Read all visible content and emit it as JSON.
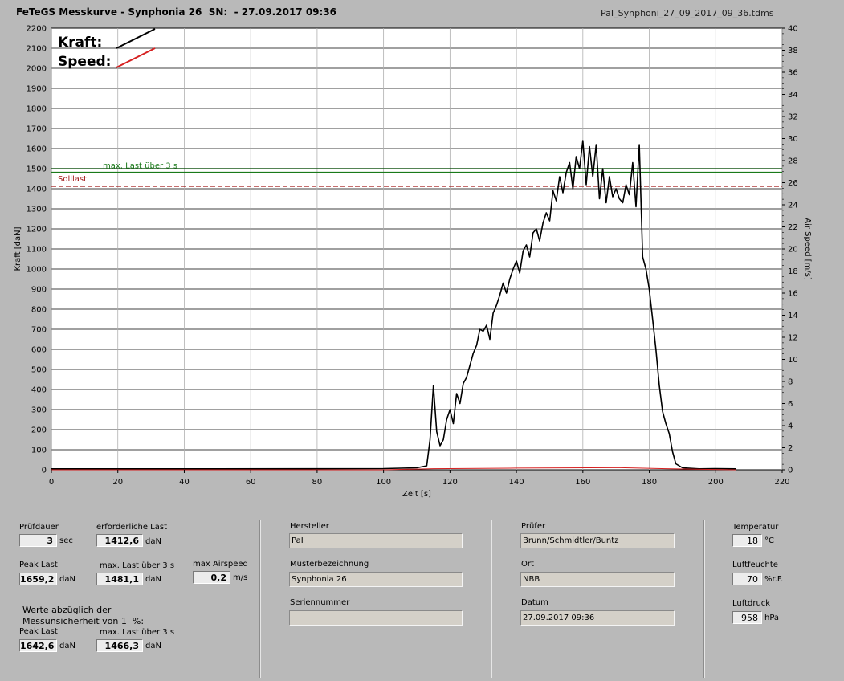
{
  "header": {
    "title": "FeTeGS Messkurve - Synphonia 26  SN:  - 27.09.2017 09:36",
    "filename": "PaI_Synphoni_27_09_2017_09_36.tdms"
  },
  "chart_data": {
    "type": "line",
    "xlabel": "Zeit [s]",
    "ylabel": "Kraft [daN]",
    "y2label": "Air Speed [m/s]",
    "xlim": [
      0,
      220
    ],
    "ylim": [
      0,
      2200
    ],
    "y2lim": [
      0,
      40
    ],
    "x_ticks": [
      0,
      20,
      40,
      60,
      80,
      100,
      120,
      140,
      160,
      180,
      200,
      220
    ],
    "y_ticks": [
      0,
      100,
      200,
      300,
      400,
      500,
      600,
      700,
      800,
      900,
      1000,
      1100,
      1200,
      1300,
      1400,
      1500,
      1600,
      1700,
      1800,
      1900,
      2000,
      2100,
      2200
    ],
    "y2_ticks": [
      0,
      2,
      4,
      6,
      8,
      10,
      12,
      14,
      16,
      18,
      20,
      22,
      24,
      26,
      28,
      30,
      32,
      34,
      36,
      38,
      40
    ],
    "grid": true,
    "legend_position": "top-left",
    "legend": [
      {
        "name": "Kraft:",
        "color": "#000000"
      },
      {
        "name": "Speed:",
        "color": "#d62020"
      }
    ],
    "reference_lines": [
      {
        "label": "max. Last über  3 s",
        "y": 1481.1,
        "color": "#1a7a1a"
      },
      {
        "label": "",
        "y": 1500,
        "color": "#1a5a1a"
      },
      {
        "label": "Solllast",
        "y": 1412.6,
        "color": "#a01818",
        "dashed": true
      }
    ],
    "series": [
      {
        "name": "Kraft",
        "color": "#000000",
        "x": [
          0,
          50,
          100,
          110,
          113,
          114,
          115,
          116,
          117,
          118,
          119,
          120,
          121,
          122,
          123,
          124,
          125,
          126,
          127,
          128,
          129,
          130,
          131,
          132,
          133,
          134,
          135,
          136,
          137,
          138,
          139,
          140,
          141,
          142,
          143,
          144,
          145,
          146,
          147,
          148,
          149,
          150,
          151,
          152,
          153,
          154,
          155,
          156,
          157,
          158,
          159,
          160,
          161,
          162,
          163,
          164,
          165,
          166,
          167,
          168,
          169,
          170,
          171,
          172,
          173,
          174,
          175,
          176,
          177,
          178,
          179,
          180,
          181,
          182,
          183,
          184,
          185,
          186,
          187,
          188,
          190,
          195,
          200,
          206
        ],
        "y": [
          5,
          5,
          6,
          10,
          20,
          150,
          420,
          190,
          120,
          150,
          250,
          300,
          230,
          380,
          330,
          430,
          460,
          520,
          580,
          620,
          700,
          690,
          720,
          650,
          780,
          820,
          870,
          930,
          880,
          950,
          1000,
          1040,
          980,
          1090,
          1120,
          1060,
          1180,
          1200,
          1140,
          1230,
          1280,
          1240,
          1390,
          1340,
          1460,
          1380,
          1480,
          1530,
          1400,
          1560,
          1500,
          1640,
          1420,
          1610,
          1460,
          1620,
          1350,
          1500,
          1330,
          1460,
          1360,
          1400,
          1350,
          1330,
          1420,
          1370,
          1530,
          1310,
          1620,
          1060,
          1000,
          900,
          750,
          600,
          420,
          290,
          230,
          180,
          90,
          30,
          10,
          5,
          6,
          5
        ]
      },
      {
        "name": "Speed",
        "color": "#d62020",
        "x": [
          0,
          50,
          100,
          115,
          140,
          170,
          185,
          206
        ],
        "y": [
          0,
          0,
          0,
          0.1,
          0.15,
          0.2,
          0.1,
          0
        ]
      }
    ]
  },
  "panel": {
    "pruefdauer_label": "Prüfdauer",
    "pruefdauer_value": "3",
    "pruefdauer_unit": "sec",
    "erf_last_label": "erforderliche Last",
    "erf_last_value": "1412,6",
    "erf_last_unit": "daN",
    "peak_last_label": "Peak Last",
    "peak_last_value": "1659,2",
    "peak_last_unit": "daN",
    "max_last_label": "max. Last über  3 s",
    "max_last_value": "1481,1",
    "max_last_unit": "daN",
    "max_airspeed_label": "max Airspeed",
    "max_airspeed_value": "0,2",
    "max_airspeed_unit": "m/s",
    "werte_note_line1": "Werte abzüglich der",
    "werte_note_line2": "Messunsicherheit von 1  %:",
    "peak_last2_label": "Peak Last",
    "peak_last2_value": "1642,6",
    "peak_last2_unit": "daN",
    "max_last2_label": "max. Last über  3 s",
    "max_last2_value": "1466,3",
    "max_last2_unit": "daN",
    "hersteller_label": "Hersteller",
    "hersteller_value": "PaI",
    "muster_label": "Musterbezeichnung",
    "muster_value": "Synphonia 26",
    "serien_label": "Seriennummer",
    "serien_value": "",
    "pruefer_label": "Prüfer",
    "pruefer_value": "Brunn/Schmidtler/Buntz",
    "ort_label": "Ort",
    "ort_value": "NBB",
    "datum_label": "Datum",
    "datum_value": "27.09.2017 09:36",
    "temp_label": "Temperatur",
    "temp_value": "18",
    "temp_unit": "°C",
    "luftfeuchte_label": "Luftfeuchte",
    "luftfeuchte_value": "70",
    "luftfeuchte_unit": "%r.F.",
    "luftdruck_label": "Luftdruck",
    "luftdruck_value": "958",
    "luftdruck_unit": "hPa"
  }
}
